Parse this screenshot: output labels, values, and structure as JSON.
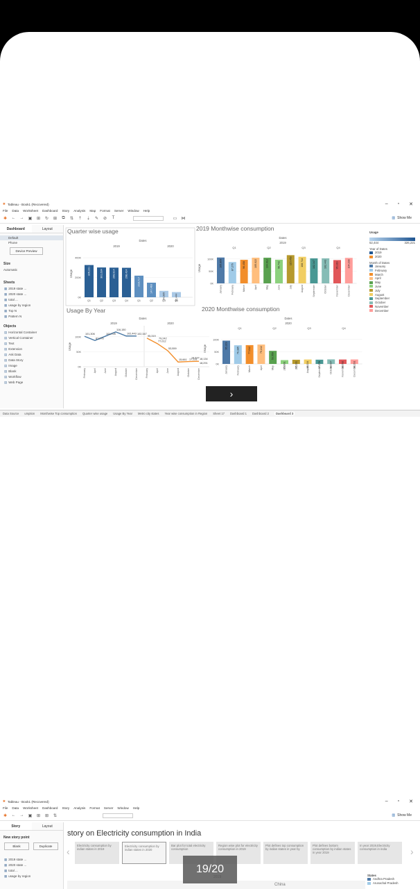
{
  "win1": {
    "title": "Tableau - Book1 (Recovered)",
    "menu": [
      "File",
      "Data",
      "Worksheet",
      "Dashboard",
      "Story",
      "Analysis",
      "Map",
      "Format",
      "Server",
      "Window",
      "Help"
    ],
    "show_me": "Show Me",
    "side_tabs": [
      "Dashboard",
      "Layout"
    ],
    "devices": [
      "Default",
      "Phone"
    ],
    "device_preview": "Device Preview",
    "size_label": "Size",
    "size_value": "Automatic",
    "sheets_label": "Sheets",
    "sheets": [
      "2019 state ...",
      "2020 state ...",
      "total ...",
      "usage by region",
      "Top N",
      "Pattern N"
    ],
    "objects_label": "Objects",
    "objects": [
      "Horizontal Container",
      "Vertical Container",
      "Text",
      "Extension",
      "Ask Data",
      "Data Story",
      "Image",
      "Blank",
      "Workflow",
      "Web Page"
    ],
    "tabs": [
      "Data Source",
      "umption",
      "Monthwise Top consumption",
      "Quarter wise usage",
      "Usage By Year",
      "Metro city states",
      "Year wise consumption in Region",
      "Sheet 17",
      "Dashboard 1",
      "Dashboard 2",
      "Dashboard 3"
    ],
    "panel_titles": {
      "q": "Quarter wise usage",
      "m19": "2019 Monthwise consumption",
      "y": "Usage By Year",
      "m20": "2020 Monthwise consumption"
    },
    "usage_legend": {
      "title": "Usage",
      "min": "52,444",
      "max": "326,221"
    },
    "year_legend": {
      "title": "Year of Dates",
      "items": [
        "2019",
        "2020"
      ]
    },
    "month_legend": {
      "title": "Month of Dates",
      "items": [
        "January",
        "February",
        "March",
        "April",
        "May",
        "June",
        "July",
        "August",
        "September",
        "October",
        "November",
        "December"
      ]
    },
    "nav_icon": "chevron-right-icon"
  },
  "chart_data": [
    {
      "type": "bar",
      "title": "Quarter wise usage",
      "header": "Dates",
      "groups": [
        "2019",
        "2020"
      ],
      "categories": [
        "Q1",
        "Q2",
        "Q3",
        "Q4",
        "Q1",
        "Q2",
        "Q3",
        "Q4"
      ],
      "values": [
        326221,
        301634,
        299914,
        298424,
        218717,
        147463,
        64905,
        52444
      ],
      "labels": [
        "326,221",
        "301,634",
        "299,914",
        "298,424",
        "218,717",
        "147,463",
        "64,905",
        "52,444"
      ],
      "ylabel": "Usage",
      "yticks": [
        "0K",
        "200K",
        "400K"
      ],
      "ylim": [
        0,
        450000
      ]
    },
    {
      "type": "bar",
      "title": "2019 Monthwise consumption",
      "header": "Dates",
      "group": "2019",
      "quarters": [
        "Q1",
        "Q2",
        "Q3",
        "Q4"
      ],
      "categories": [
        "January",
        "February",
        "March",
        "April",
        "May",
        "June",
        "July",
        "August",
        "September",
        "October",
        "November",
        "December"
      ],
      "values": [
        105809,
        87276,
        96458,
        105022,
        104912,
        96742,
        115453,
        108714,
        102347,
        102443,
        95319,
        104193
      ],
      "labels": [
        "105,809",
        "87,276",
        "96,458",
        "105,022",
        "104,912",
        "96,742",
        "115,453",
        "108,714",
        "102,347",
        "102,443",
        "95,319",
        "104,193"
      ],
      "ylabel": "Usage",
      "yticks": [
        "0K",
        "50K",
        "100K"
      ],
      "ylim": [
        0,
        125000
      ]
    },
    {
      "type": "line",
      "title": "Usage By Year",
      "header": "Dates",
      "groups": [
        "2019",
        "2020"
      ],
      "categories": [
        "February",
        "April",
        "June",
        "August",
        "October",
        "December",
        "February",
        "April",
        "June",
        "August",
        "October",
        "December"
      ],
      "values": [
        101306,
        87276,
        101728,
        116150,
        102443,
        102347,
        95319,
        77012,
        53559,
        15661,
        17131,
        18134
      ],
      "labels": [
        "101,306",
        "87,276",
        "101,728",
        "116,150",
        "102,443",
        "102,347",
        "95,319",
        "77,012",
        "53,559",
        "15,661",
        "17,131",
        "18,134"
      ],
      "extra_labels": [
        "79,242",
        "18,637",
        "18,291"
      ],
      "ylabel": "Usage",
      "yticks": [
        "0K",
        "50K",
        "100K"
      ],
      "ylim": [
        0,
        125000
      ]
    },
    {
      "type": "bar",
      "title": "2020 Monthwise consumption",
      "header": "Dates",
      "group": "2020",
      "quarters": [
        "Q1",
        "Q2",
        "Q3",
        "Q4"
      ],
      "categories": [
        "January",
        "February",
        "March",
        "April",
        "May",
        "June",
        "July",
        "August",
        "September",
        "October",
        "November",
        "December"
      ],
      "values": [
        95319,
        76385,
        77012,
        79242,
        53559,
        15661,
        17131,
        18134,
        17378,
        18637,
        18092,
        18291
      ],
      "labels": [
        "95,319",
        "76,385",
        "77,012",
        "79,242",
        "53,559",
        "15,661",
        "17,131",
        "18,134",
        "17,378",
        "18,637",
        "18,092",
        "18,291"
      ],
      "ylabel": "Usage",
      "yticks": [
        "0K",
        "50K",
        "100K"
      ],
      "ylim": [
        0,
        125000
      ]
    }
  ],
  "colors": {
    "January": "#4e79a7",
    "February": "#a0cbe8",
    "March": "#f28e2b",
    "April": "#ffbe7d",
    "May": "#59a14f",
    "June": "#8cd17d",
    "July": "#b6992d",
    "August": "#f1ce63",
    "September": "#499894",
    "October": "#86bcb6",
    "November": "#e15759",
    "December": "#ff9d9a",
    "y2019": "#1f5591",
    "y2020": "#f28e2b",
    "line2019": "#4a79a5",
    "line2020": "#f28e2b"
  },
  "win2": {
    "title": "Tableau - Book1 (Recovered)",
    "menu": [
      "File",
      "Data",
      "Worksheet",
      "Dashboard",
      "Story",
      "Analysis",
      "Format",
      "Server",
      "Window",
      "Help"
    ],
    "show_me": "Show Me",
    "side_tabs": [
      "Story",
      "Layout"
    ],
    "new_story_label": "New story point",
    "blank": "Blank",
    "duplicate": "Duplicate",
    "sheets": [
      "2019 state ...",
      "2020 state ...",
      "total ...",
      "usage by region"
    ],
    "story_title": "story on  Electricity consumption in India",
    "story_points": [
      "Electricity consumption by indian states in 2019",
      "Electricity consumption by indian states in 2020",
      "Bar plot for total electricity consumption",
      "Region wise plot for electricity consumption in 2019",
      "Plot defines top consumption by indian states in year by",
      "Plot defines bottom consumption by indian states in year 2019",
      "In year 2019,Electricity consumption in india"
    ],
    "states_label": "States",
    "states": [
      "Andhra Pradesh",
      "Arunachal Pradesh"
    ],
    "map_labels": [
      "China",
      "2019"
    ],
    "pager": "19/20"
  }
}
